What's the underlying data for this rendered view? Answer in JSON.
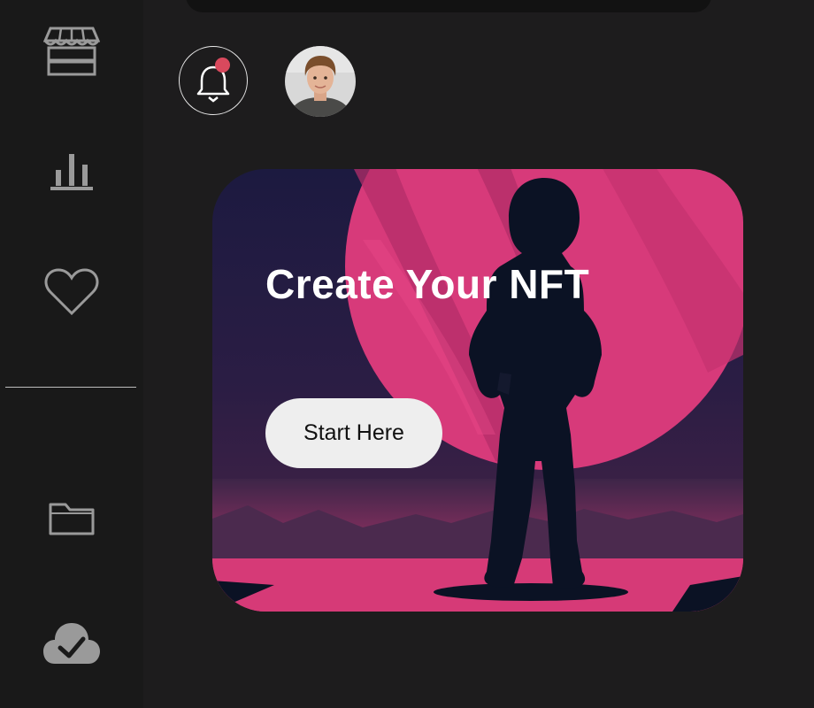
{
  "sidebar": {
    "items": [
      {
        "icon": "storefront-icon",
        "name": "sidebar-item-marketplace"
      },
      {
        "icon": "bar-chart-icon",
        "name": "sidebar-item-stats"
      },
      {
        "icon": "heart-icon",
        "name": "sidebar-item-favorites"
      },
      {
        "icon": "folder-icon",
        "name": "sidebar-item-collection"
      },
      {
        "icon": "cloud-check-icon",
        "name": "sidebar-item-cloud"
      }
    ]
  },
  "header": {
    "notification": {
      "icon": "bell-icon",
      "has_unread": true,
      "dot_color": "#d9495d"
    },
    "avatar": {
      "icon": "avatar"
    }
  },
  "banner": {
    "title": "Create Your NFT",
    "button_label": "Start Here",
    "colors": {
      "pink": "#d9397a",
      "navy": "#0b1224"
    }
  }
}
